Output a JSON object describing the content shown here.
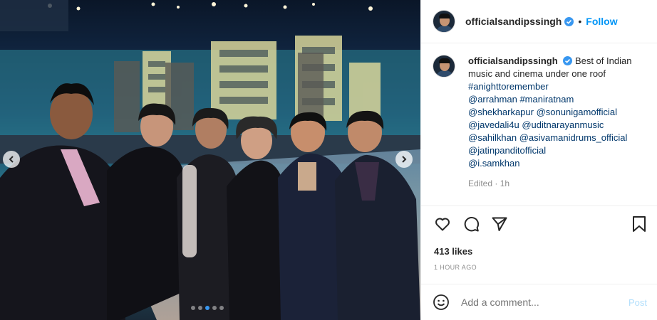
{
  "post": {
    "username": "officialsandipssingh",
    "follow_label": "Follow",
    "separator": "•",
    "caption_text": "Best of Indian music and cinema under one roof",
    "tags": [
      "#anighttoremember",
      "@arrahman #maniratnam",
      "@shekharkapur @sonunigamofficial",
      "@javedali4u @uditnarayanmusic",
      "@sahilkhan @asivamanidrums_official",
      "@jatinpanditofficial",
      "@i.samkhan"
    ],
    "edited_label": "Edited · 1h",
    "likes": "413 likes",
    "timestamp": "1 HOUR AGO",
    "comment_placeholder": "Add a comment...",
    "post_label": "Post"
  },
  "carousel": {
    "total_slides": 5,
    "active_slide": 2
  },
  "icons": {
    "verified": "verified-badge-icon",
    "like": "heart-icon",
    "comment": "comment-icon",
    "share": "share-icon",
    "save": "bookmark-icon",
    "emoji": "emoji-icon",
    "prev": "chevron-left-icon",
    "next": "chevron-right-icon"
  },
  "colors": {
    "link": "#00376b",
    "follow": "#0095f6",
    "verified": "#3897f0",
    "muted": "#8e8e8e"
  }
}
